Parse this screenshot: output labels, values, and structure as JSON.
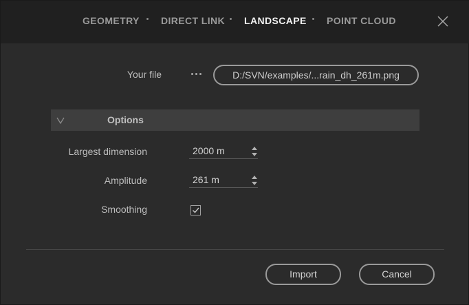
{
  "tabs": [
    {
      "label": "GEOMETRY",
      "active": false
    },
    {
      "label": "DIRECT LINK",
      "active": false
    },
    {
      "label": "LANDSCAPE",
      "active": true
    },
    {
      "label": "POINT CLOUD",
      "active": false
    }
  ],
  "file": {
    "label": "Your file",
    "value": "D:/SVN/examples/...rain_dh_261m.png"
  },
  "options": {
    "title": "Options",
    "largest_dimension": {
      "label": "Largest dimension",
      "value": "2000 m"
    },
    "amplitude": {
      "label": "Amplitude",
      "value": "261 m"
    },
    "smoothing": {
      "label": "Smoothing",
      "checked": true
    }
  },
  "buttons": {
    "import": "Import",
    "cancel": "Cancel"
  },
  "icons": {
    "close": "close-icon",
    "browse": "ellipsis-icon",
    "collapse": "chevron-down-icon",
    "spinner": "spinner-arrows-icon",
    "check": "checkmark-icon"
  },
  "colors": {
    "background": "#2b2b2b",
    "topbar": "#202020",
    "section": "#3e3e3e",
    "active_tab": "#f2f2f2",
    "inactive_tab": "#9a9a9a"
  }
}
